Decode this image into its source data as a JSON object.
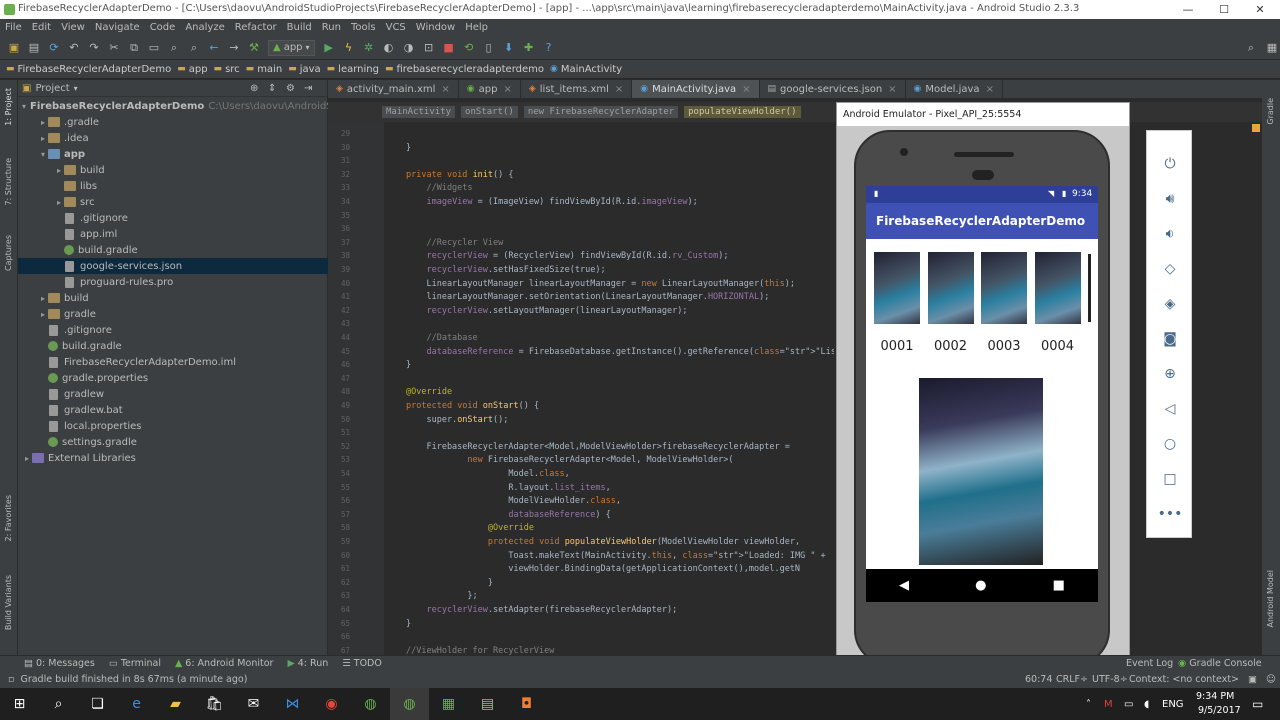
{
  "window": {
    "title": "FirebaseRecyclerAdapterDemo - [C:\\Users\\daovu\\AndroidStudioProjects\\FirebaseRecyclerAdapterDemo] - [app] - ...\\app\\src\\main\\java\\learning\\firebaserecycleradapterdemo\\MainActivity.java - Android Studio 2.3.3"
  },
  "menu": [
    "File",
    "Edit",
    "View",
    "Navigate",
    "Code",
    "Analyze",
    "Refactor",
    "Build",
    "Run",
    "Tools",
    "VCS",
    "Window",
    "Help"
  ],
  "toolbar": {
    "run_config": "app"
  },
  "navbar": [
    "FirebaseRecyclerAdapterDemo",
    "app",
    "src",
    "main",
    "java",
    "learning",
    "firebaserecycleradapterdemo",
    "MainActivity"
  ],
  "project": {
    "header": "Project",
    "tree": [
      {
        "label": "FirebaseRecyclerAdapterDemo",
        "hint": "C:\\Users\\daovu\\AndroidStudioPr"
      },
      {
        "label": ".gradle"
      },
      {
        "label": ".idea"
      },
      {
        "label": "app"
      },
      {
        "label": "build"
      },
      {
        "label": "libs"
      },
      {
        "label": "src"
      },
      {
        "label": ".gitignore"
      },
      {
        "label": "app.iml"
      },
      {
        "label": "build.gradle"
      },
      {
        "label": "google-services.json"
      },
      {
        "label": "proguard-rules.pro"
      },
      {
        "label": "build"
      },
      {
        "label": "gradle"
      },
      {
        "label": ".gitignore"
      },
      {
        "label": "build.gradle"
      },
      {
        "label": "FirebaseRecyclerAdapterDemo.iml"
      },
      {
        "label": "gradle.properties"
      },
      {
        "label": "gradlew"
      },
      {
        "label": "gradlew.bat"
      },
      {
        "label": "local.properties"
      },
      {
        "label": "settings.gradle"
      },
      {
        "label": "External Libraries"
      }
    ]
  },
  "tabs": [
    "activity_main.xml",
    "app",
    "list_items.xml",
    "MainActivity.java",
    "google-services.json",
    "Model.java"
  ],
  "breadcrumbs": [
    "MainActivity",
    "onStart()",
    "new FirebaseRecyclerAdapter",
    "populateViewHolder()"
  ],
  "line_numbers": [
    "29",
    "30",
    "31",
    "32",
    "33",
    "34",
    "35",
    "36",
    "37",
    "38",
    "39",
    "40",
    "41",
    "42",
    "43",
    "44",
    "45",
    "46",
    "47",
    "48",
    "49",
    "50",
    "51",
    "52",
    "53",
    "54",
    "55",
    "56",
    "57",
    "58",
    "59",
    "60",
    "61",
    "62",
    "63",
    "64",
    "65",
    "66",
    "67",
    "68"
  ],
  "code": [
    "}",
    "",
    "private void init() {",
    "    //Widgets",
    "    imageView = (ImageView) findViewById(R.id.imageView);",
    "",
    "",
    "    //Recycler View",
    "    recyclerView = (RecyclerView) findViewById(R.id.rv_Custom);",
    "    recyclerView.setHasFixedSize(true);",
    "    LinearLayoutManager linearLayoutManager = new LinearLayoutManager(this);",
    "    linearLayoutManager.setOrientation(LinearLayoutManager.HORIZONTAL);",
    "    recyclerView.setLayoutManager(linearLayoutManager);",
    "",
    "    //Database",
    "    databaseReference = FirebaseDatabase.getInstance().getReference(\"ListData",
    "}",
    "",
    "@Override",
    "protected void onStart() {",
    "    super.onStart();",
    "",
    "    FirebaseRecyclerAdapter<Model,ModelViewHolder>firebaseRecyclerAdapter =",
    "            new FirebaseRecyclerAdapter<Model, ModelViewHolder>(",
    "                    Model.class,",
    "                    R.layout.list_items,",
    "                    ModelViewHolder.class,",
    "                    databaseReference) {",
    "                @Override",
    "                protected void populateViewHolder(ModelViewHolder viewHolder,",
    "                    Toast.makeText(MainActivity.this, \"Loaded: IMG \" +  model",
    "                    viewHolder.BindingData(getApplicationContext(),model.getN",
    "                }",
    "            };",
    "    recyclerView.setAdapter(firebaseRecyclerAdapter);",
    "}",
    "",
    "//ViewHolder for RecyclerView"
  ],
  "emulator": {
    "title": "Android Emulator - Pixel_API_25:5554",
    "clock": "9:34",
    "app_title": "FirebaseRecyclerAdapterDemo",
    "items": [
      "0001",
      "0002",
      "0003",
      "0004"
    ]
  },
  "bottom_tools": [
    "0: Messages",
    "Terminal",
    "6: Android Monitor",
    "4: Run",
    "TODO",
    "Event Log",
    "Gradle Console"
  ],
  "status": {
    "message": "Gradle build finished in 8s 67ms (a minute ago)",
    "position": "60:74",
    "line_sep": "CRLF÷",
    "encoding": "UTF-8÷",
    "context": "Context: <no context>"
  },
  "taskbar": {
    "lang": "ENG",
    "time": "9:34 PM",
    "date": "9/5/2017"
  },
  "side_labels": {
    "left": [
      "1: Project",
      "7: Structure",
      "Captures",
      "2: Favorites",
      "Build Variants"
    ],
    "right": [
      "Gradle",
      "Android Model"
    ]
  }
}
